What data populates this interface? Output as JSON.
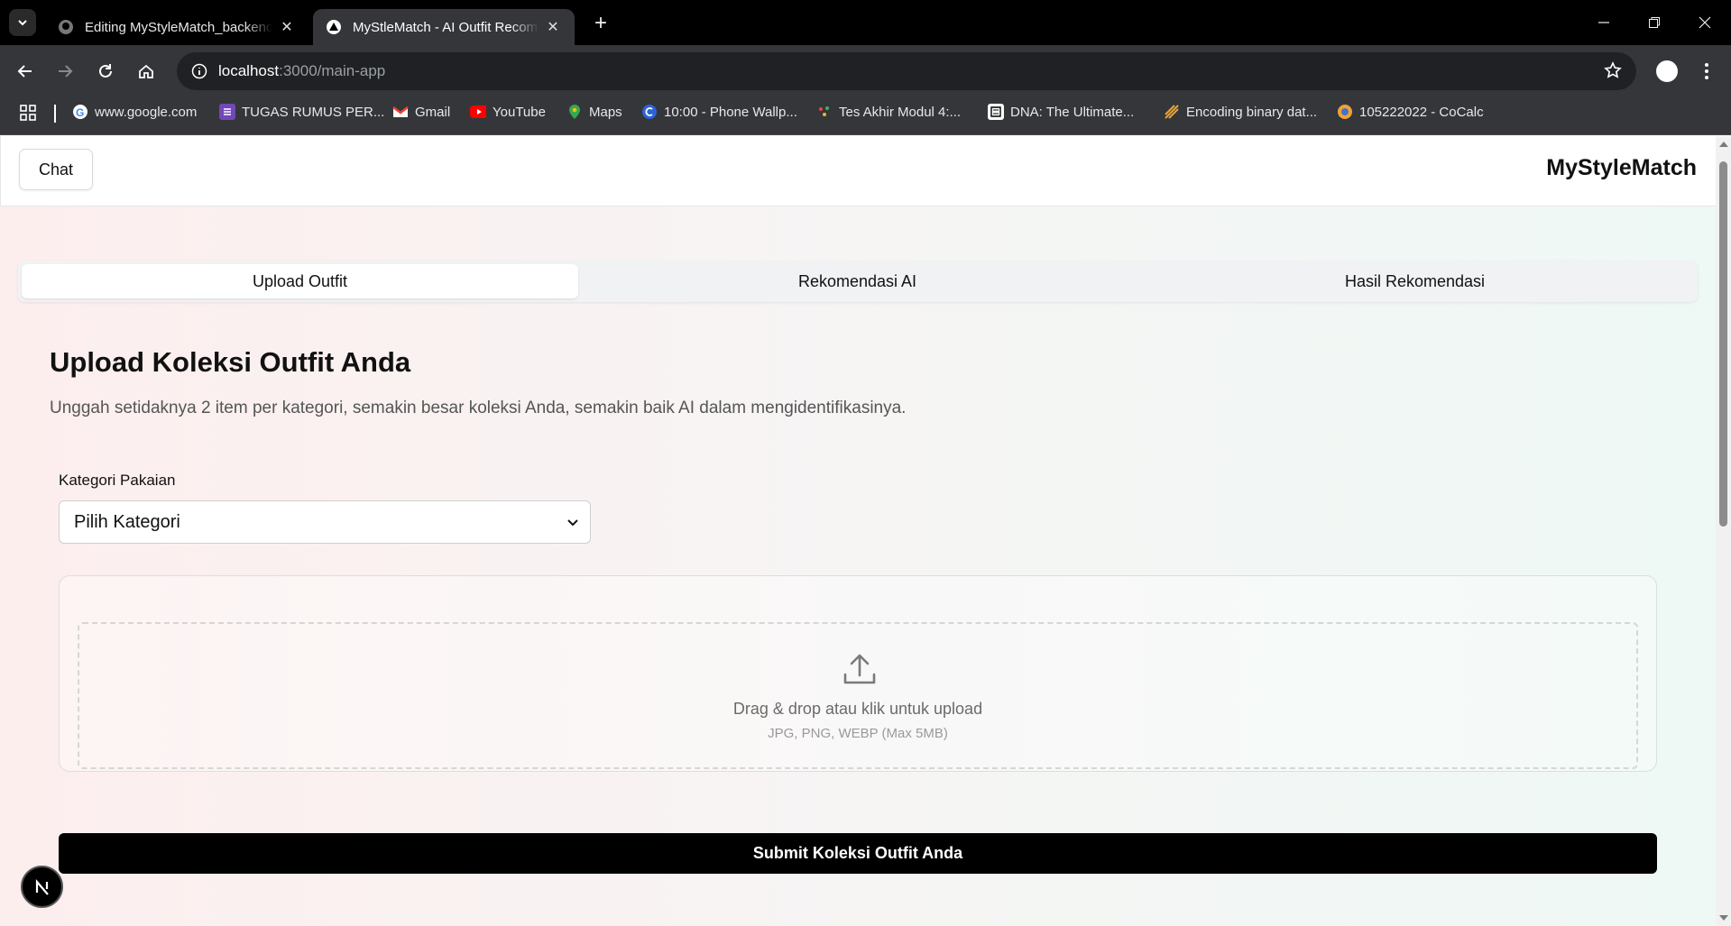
{
  "browser": {
    "tabs": [
      {
        "title": "Editing MyStyleMatch_backend/",
        "icon": "github-icon"
      },
      {
        "title": "MyStleMatch - AI Outfit Recomm",
        "icon": "nextjs-triangle-icon"
      }
    ],
    "url_host": "localhost",
    "url_path": ":3000/main-app",
    "bookmarks": [
      {
        "label": "www.google.com",
        "icon": "google-icon"
      },
      {
        "label": "TUGAS RUMUS PER...",
        "icon": "forms-icon"
      },
      {
        "label": "Gmail",
        "icon": "gmail-icon"
      },
      {
        "label": "YouTube",
        "icon": "youtube-icon"
      },
      {
        "label": "Maps",
        "icon": "maps-icon"
      },
      {
        "label": "10:00 - Phone Wallp...",
        "icon": "wallpaper-icon"
      },
      {
        "label": "Tes Akhir Modul 4:...",
        "icon": "quiz-icon"
      },
      {
        "label": "DNA: The Ultimate...",
        "icon": "dna-icon"
      },
      {
        "label": "Encoding binary dat...",
        "icon": "encoding-icon"
      },
      {
        "label": "105222022 - CoCalc",
        "icon": "cocalc-icon"
      }
    ]
  },
  "header": {
    "chat_label": "Chat",
    "brand": "MyStyleMatch"
  },
  "tabs": [
    {
      "label": "Upload Outfit",
      "selected": true
    },
    {
      "label": "Rekomendasi AI",
      "selected": false
    },
    {
      "label": "Hasil Rekomendasi",
      "selected": false
    }
  ],
  "upload": {
    "title": "Upload Koleksi Outfit Anda",
    "description": "Unggah setidaknya 2 item per kategori, semakin besar koleksi Anda, semakin baik AI dalam mengidentifikasinya.",
    "category_label": "Kategori Pakaian",
    "category_value": "Pilih Kategori",
    "dropzone_text": "Drag & drop atau klik untuk upload",
    "dropzone_hint": "JPG, PNG, WEBP (Max 5MB)",
    "submit_label": "Submit Koleksi Outfit Anda"
  },
  "colors": {
    "accent": "#000000",
    "chrome_bg": "#35363a"
  }
}
